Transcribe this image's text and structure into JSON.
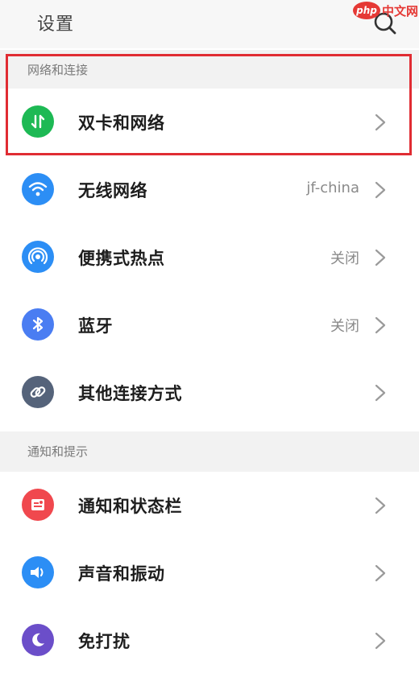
{
  "header": {
    "title": "设置"
  },
  "watermark": {
    "logo_text": "php",
    "text": "中文网"
  },
  "sections": [
    {
      "label": "网络和连接",
      "items": [
        {
          "label": "双卡和网络",
          "value": "",
          "icon": "dual-sim-icon",
          "color": "#1db954"
        },
        {
          "label": "无线网络",
          "value": "jf-china",
          "icon": "wifi-icon",
          "color": "#2c8ef5"
        },
        {
          "label": "便携式热点",
          "value": "关闭",
          "icon": "hotspot-icon",
          "color": "#2c8ef5"
        },
        {
          "label": "蓝牙",
          "value": "关闭",
          "icon": "bluetooth-icon",
          "color": "#4a7df2"
        },
        {
          "label": "其他连接方式",
          "value": "",
          "icon": "link-icon",
          "color": "#55637a"
        }
      ]
    },
    {
      "label": "通知和提示",
      "items": [
        {
          "label": "通知和状态栏",
          "value": "",
          "icon": "notification-icon",
          "color": "#f0484e"
        },
        {
          "label": "声音和振动",
          "value": "",
          "icon": "sound-icon",
          "color": "#2c8ef5"
        },
        {
          "label": "免打扰",
          "value": "",
          "icon": "moon-icon",
          "color": "#6b4ec9"
        }
      ]
    }
  ]
}
